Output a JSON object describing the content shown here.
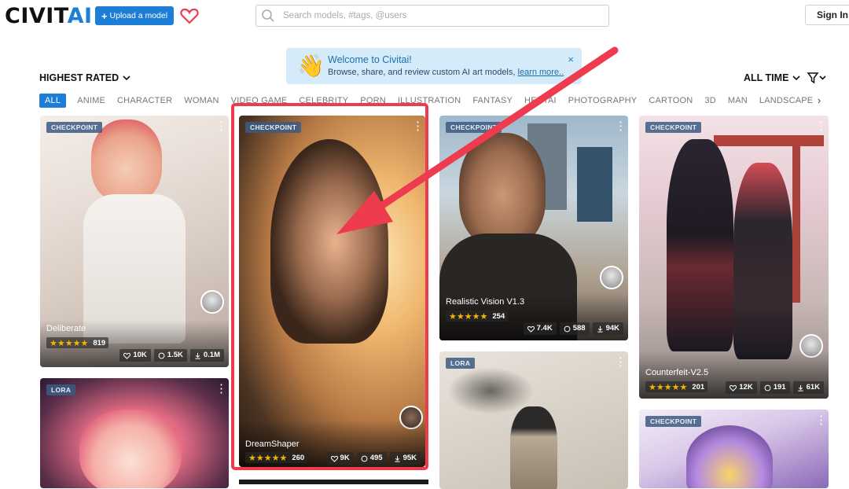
{
  "header": {
    "logo_text": "CIVIT",
    "logo_accent": "AI",
    "upload_label": "Upload a model",
    "upload_icon": "plus-icon",
    "favorites_icon": "heart-icon",
    "search_placeholder": "Search models, #tags, @users",
    "signin_label": "Sign In"
  },
  "welcome": {
    "emoji": "👋",
    "title": "Welcome to Civitai!",
    "text": "Browse, share, and review custom AI art models,",
    "link": "learn more..",
    "close": "×"
  },
  "toolbar": {
    "sort_label": "HIGHEST RATED",
    "period_label": "ALL TIME",
    "filter_icon": "filter-icon"
  },
  "tags": [
    "ALL",
    "ANIME",
    "CHARACTER",
    "WOMAN",
    "VIDEO GAME",
    "CELEBRITY",
    "PORN",
    "ILLUSTRATION",
    "FANTASY",
    "HENTAI",
    "PHOTOGRAPHY",
    "CARTOON",
    "3D",
    "MAN",
    "LANDSCAPE"
  ],
  "active_tag": "ALL",
  "cards": [
    {
      "badge": "CHECKPOINT",
      "name": "Deliberate",
      "rating_count": "819",
      "likes": "10K",
      "comments": "1.5K",
      "downloads": "0.1M"
    },
    {
      "badge": "CHECKPOINT",
      "name": "DreamShaper",
      "rating_count": "260",
      "likes": "9K",
      "comments": "495",
      "downloads": "95K"
    },
    {
      "badge": "CHECKPOINT",
      "name": "Realistic Vision V1.3",
      "rating_count": "254",
      "likes": "7.4K",
      "comments": "588",
      "downloads": "94K"
    },
    {
      "badge": "CHECKPOINT",
      "name": "Counterfeit-V2.5",
      "rating_count": "201",
      "likes": "12K",
      "comments": "191",
      "downloads": "61K"
    },
    {
      "badge": "LORA"
    },
    {
      "badge": "LORA"
    },
    {
      "badge": "CHECKPOINT"
    }
  ],
  "stars": "★★★★★",
  "colors": {
    "accent": "#1c7ed6",
    "highlight": "#ee3c4e",
    "welcome_bg": "#d5ebfa",
    "star": "#f5b400"
  }
}
